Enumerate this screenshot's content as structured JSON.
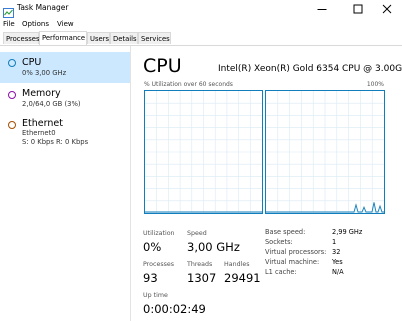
{
  "window": {
    "title": "Task Manager",
    "controls": [
      "minimize",
      "maximize",
      "close"
    ]
  },
  "menu": [
    "File",
    "Options",
    "View"
  ],
  "tabs": [
    "Processes",
    "Performance",
    "Users",
    "Details",
    "Services"
  ],
  "active_tab": "Performance",
  "resources": [
    {
      "name": "CPU",
      "sub1": "0% 3,00 GHz",
      "sub2": "",
      "color": "#117dbb",
      "selected": true
    },
    {
      "name": "Memory",
      "sub1": "2,0/64,0 GB (3%)",
      "sub2": "",
      "color": "#8b12ae",
      "selected": false
    },
    {
      "name": "Ethernet",
      "sub1": "Ethernet0",
      "sub2": "S: 0 Kbps R: 0 Kbps",
      "color": "#a74f01",
      "selected": false
    }
  ],
  "main": {
    "title": "CPU",
    "model": "Intel(R) Xeon(R) Gold 6354 CPU @ 3.00GHz",
    "graph_label": "% Utilization over 60 seconds",
    "graph_max": "100%",
    "graph_color": "#117dbb",
    "stats": {
      "utilization_label": "Utilization",
      "utilization": "0%",
      "speed_label": "Speed",
      "speed": "3,00 GHz",
      "processes_label": "Processes",
      "processes": "93",
      "threads_label": "Threads",
      "threads": "1307",
      "handles_label": "Handles",
      "handles": "29491",
      "uptime_label": "Up time",
      "uptime": "0:00:02:49"
    },
    "info": [
      {
        "key": "Base speed:",
        "value": "2,99 GHz"
      },
      {
        "key": "Sockets:",
        "value": "1"
      },
      {
        "key": "Virtual processors:",
        "value": "32"
      },
      {
        "key": "Virtual machine:",
        "value": "Yes"
      },
      {
        "key": "L1 cache:",
        "value": "N/A"
      }
    ]
  },
  "chart_data": {
    "type": "line",
    "title": "% Utilization over 60 seconds",
    "ylim": [
      0,
      100
    ],
    "series": [
      {
        "values": [
          0,
          0,
          0,
          0,
          0,
          0,
          0,
          0,
          0,
          0,
          0,
          0,
          0,
          0,
          0,
          0,
          0,
          0,
          0,
          0,
          0,
          0,
          0,
          0,
          0,
          0,
          0,
          0,
          0,
          0,
          0,
          0,
          0,
          0,
          0,
          0,
          0,
          0,
          0,
          0,
          0,
          0,
          0,
          0,
          0,
          0,
          0,
          0,
          0,
          0,
          0,
          0,
          0,
          0,
          0,
          0,
          0,
          0,
          0,
          0
        ]
      },
      {
        "values": [
          0,
          0,
          0,
          0,
          0,
          0,
          0,
          0,
          0,
          0,
          0,
          0,
          0,
          0,
          0,
          0,
          0,
          0,
          0,
          0,
          0,
          0,
          0,
          0,
          0,
          0,
          0,
          0,
          0,
          0,
          0,
          0,
          0,
          0,
          0,
          0,
          0,
          0,
          0,
          0,
          0,
          0,
          0,
          0,
          0,
          6,
          0,
          0,
          0,
          4,
          0,
          0,
          0,
          0,
          8,
          0,
          0,
          5,
          0,
          0
        ]
      }
    ]
  }
}
